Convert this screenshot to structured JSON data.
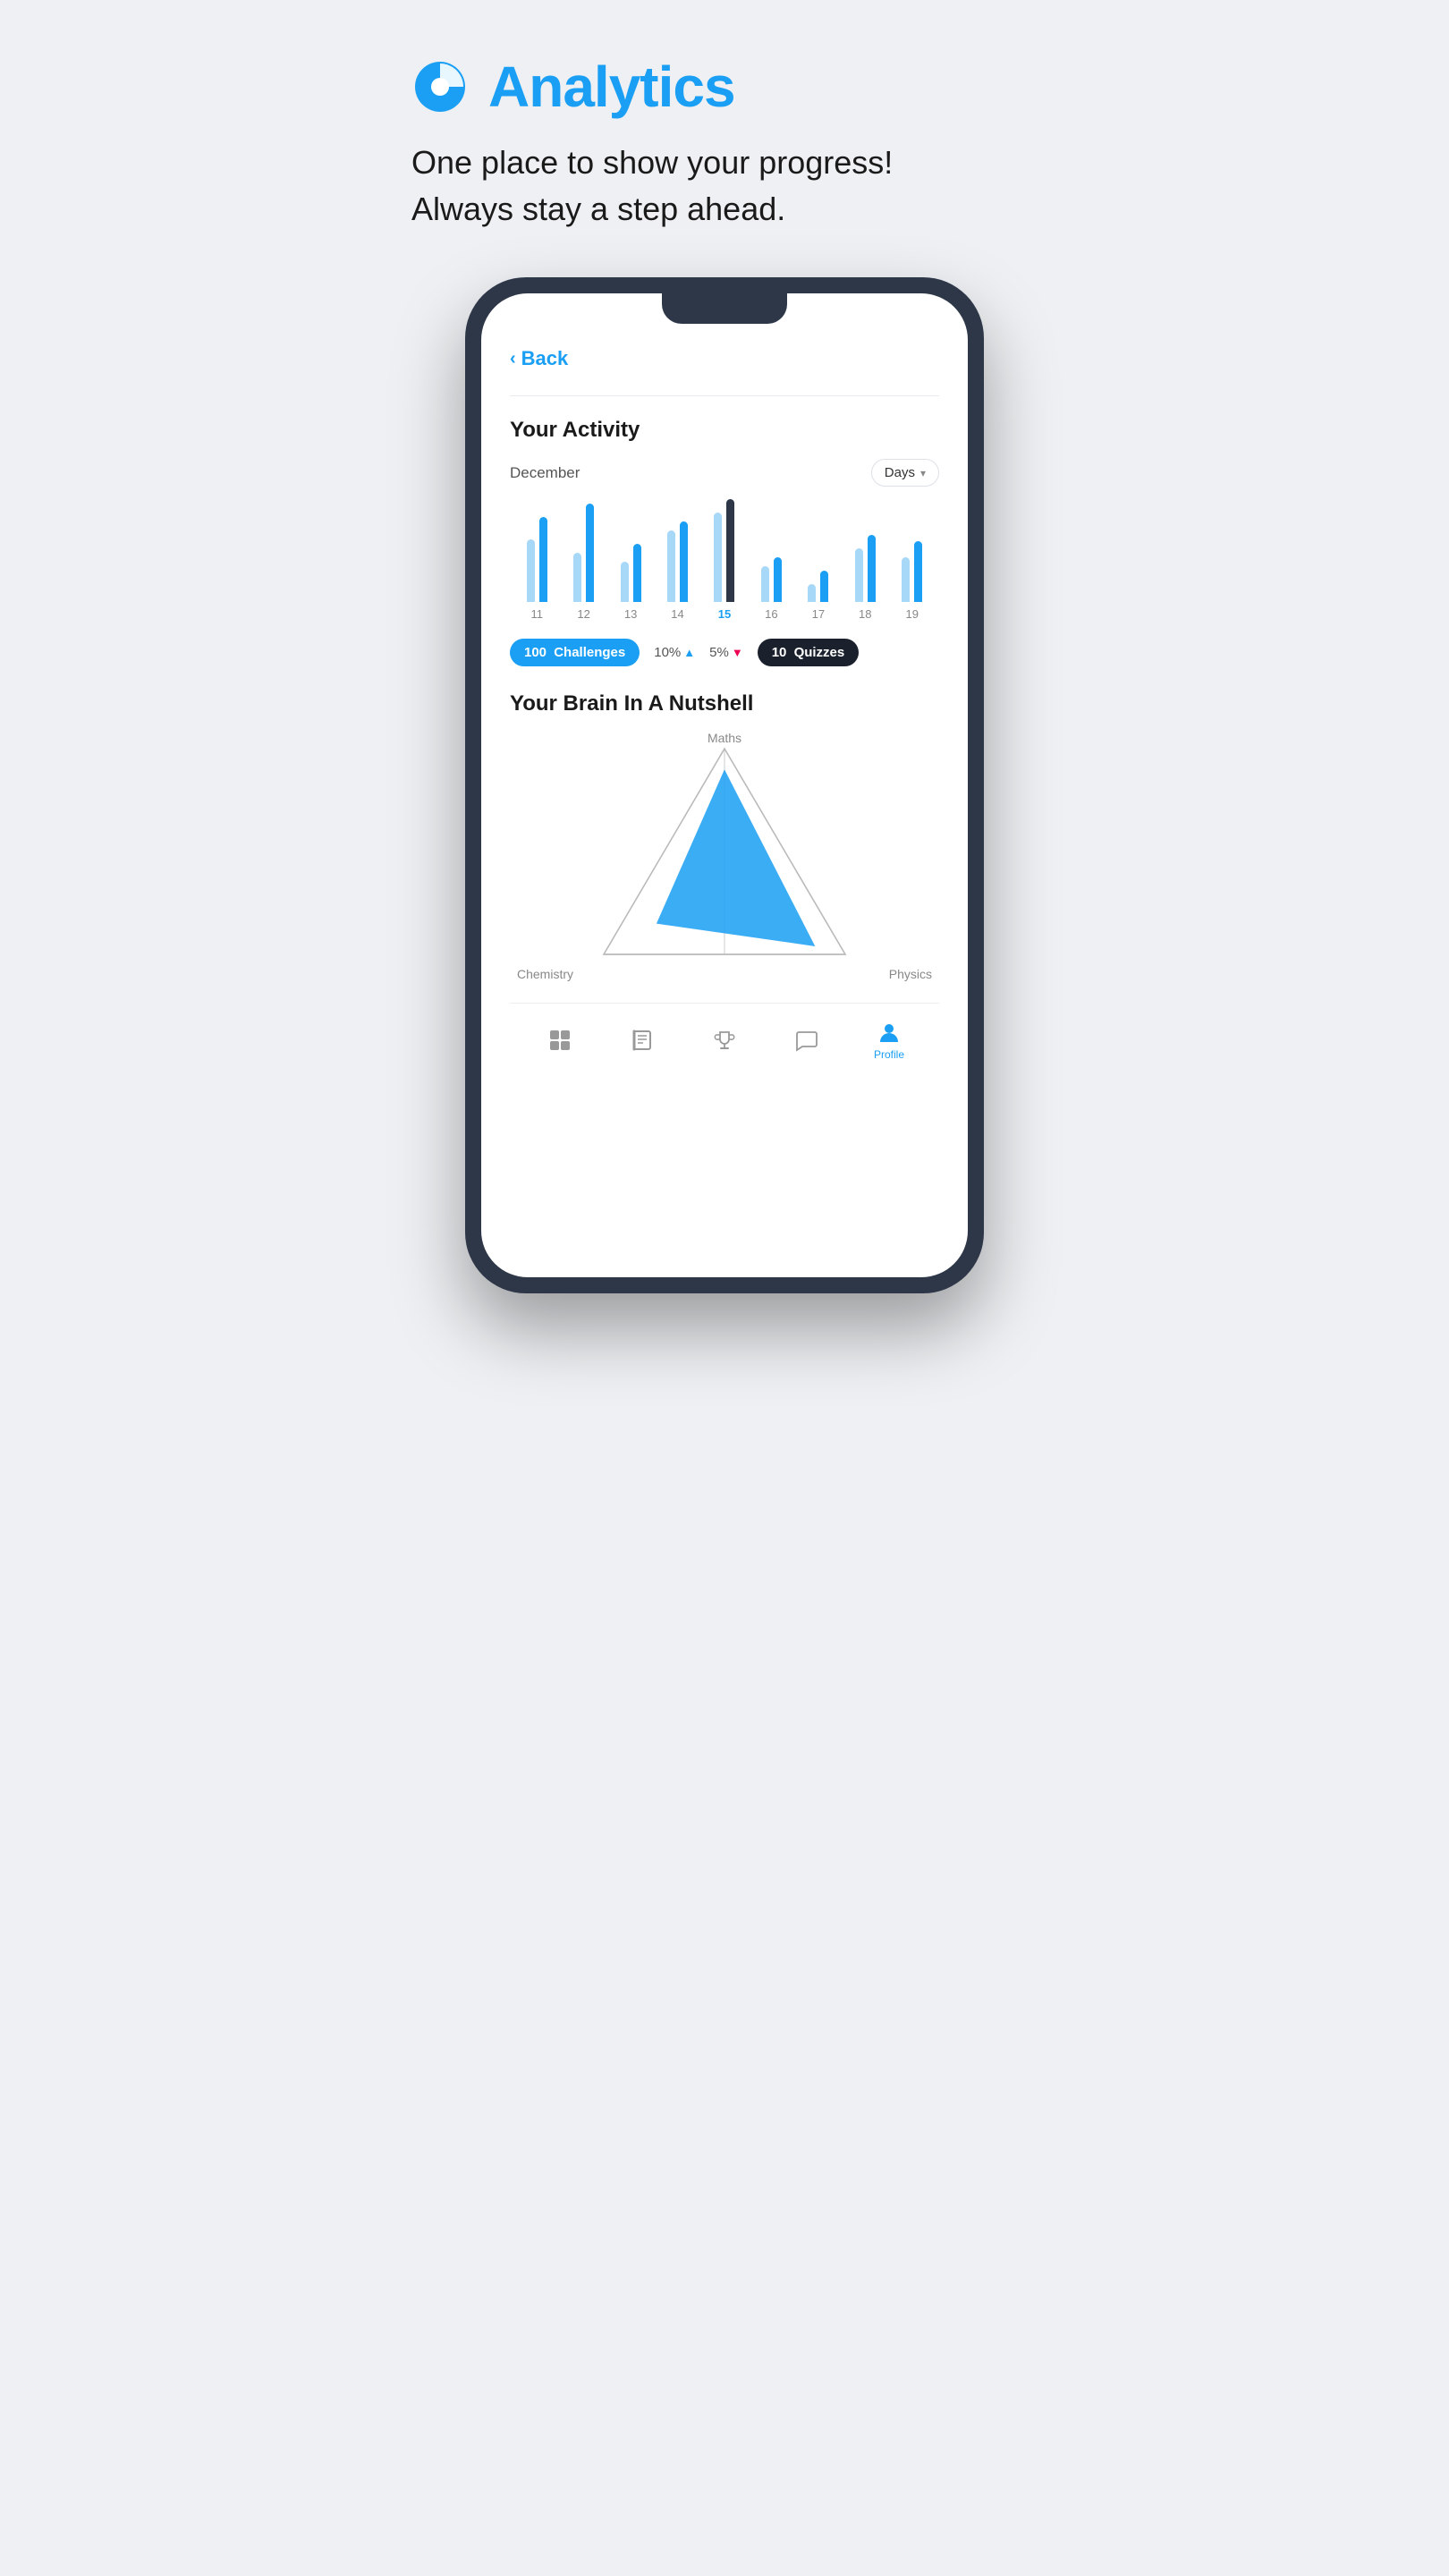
{
  "page": {
    "background": "#eef0f3",
    "title": "Analytics",
    "subtitle_line1": "One place to show your progress!",
    "subtitle_line2": "Always stay a step ahead."
  },
  "phone": {
    "back_label": "Back",
    "activity_section": {
      "title": "Your Activity",
      "month": "December",
      "filter_label": "Days",
      "bars": [
        {
          "day": "11",
          "bar1_h": 70,
          "bar2_h": 95,
          "active": false
        },
        {
          "day": "12",
          "bar1_h": 55,
          "bar2_h": 110,
          "active": false
        },
        {
          "day": "13",
          "bar1_h": 45,
          "bar2_h": 65,
          "active": false
        },
        {
          "day": "14",
          "bar1_h": 80,
          "bar2_h": 90,
          "active": false
        },
        {
          "day": "15",
          "bar1_h": 100,
          "bar2_h": 115,
          "active": true
        },
        {
          "day": "16",
          "bar1_h": 40,
          "bar2_h": 50,
          "active": false
        },
        {
          "day": "17",
          "bar1_h": 20,
          "bar2_h": 35,
          "active": false
        },
        {
          "day": "18",
          "bar1_h": 60,
          "bar2_h": 75,
          "active": false
        },
        {
          "day": "19",
          "bar1_h": 50,
          "bar2_h": 68,
          "active": false
        }
      ],
      "stats": {
        "challenges_count": "100",
        "challenges_label": "Challenges",
        "change1_value": "10%",
        "change1_direction": "up",
        "change2_value": "5%",
        "change2_direction": "down",
        "quizzes_count": "10",
        "quizzes_label": "Quizzes"
      }
    },
    "brain_section": {
      "title": "Your Brain In A Nutshell",
      "labels": {
        "top": "Maths",
        "bottom_left": "Chemistry",
        "bottom_right": "Physics"
      }
    },
    "bottom_nav": [
      {
        "label": "Home",
        "icon": "grid-icon",
        "active": false
      },
      {
        "label": "Books",
        "icon": "book-icon",
        "active": false
      },
      {
        "label": "Trophy",
        "icon": "trophy-icon",
        "active": false
      },
      {
        "label": "Chat",
        "icon": "chat-icon",
        "active": false
      },
      {
        "label": "Profile",
        "icon": "profile-icon",
        "active": true
      }
    ]
  }
}
